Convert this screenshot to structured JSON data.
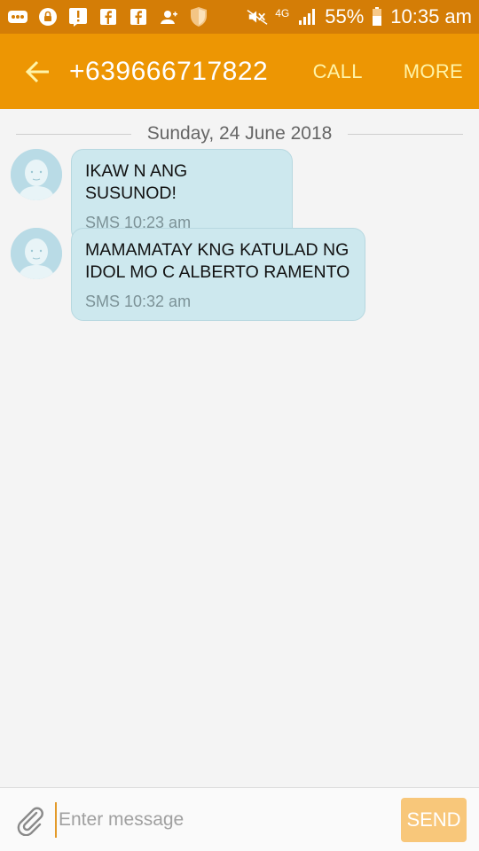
{
  "status_bar": {
    "icons": [
      "more-icon",
      "lock-icon",
      "alert-icon",
      "facebook-icon",
      "facebook-icon",
      "person-add-icon",
      "shield-icon",
      "mute-icon",
      "4g-icon",
      "signal-icon",
      "battery-icon"
    ],
    "network": "4G",
    "battery": "55%",
    "time": "10:35 am"
  },
  "app_bar": {
    "title": "+639666717822",
    "call_label": "CALL",
    "more_label": "MORE"
  },
  "conversation": {
    "date": "Sunday, 24 June 2018",
    "messages": [
      {
        "text": "IKAW N ANG SUSUNOD!",
        "meta": "SMS 10:23 am"
      },
      {
        "text": "MAMAMATAY KNG KATULAD NG IDOL MO C ALBERTO RAMENTO",
        "meta": "SMS 10:32 am"
      }
    ]
  },
  "composer": {
    "placeholder": "Enter message",
    "value": "",
    "send_label": "SEND"
  },
  "colors": {
    "status_bar": "#d47d06",
    "app_bar": "#ed9603",
    "action_text": "#fff4a8",
    "bubble": "#cde8ee",
    "send_disabled": "#f8c77a"
  }
}
